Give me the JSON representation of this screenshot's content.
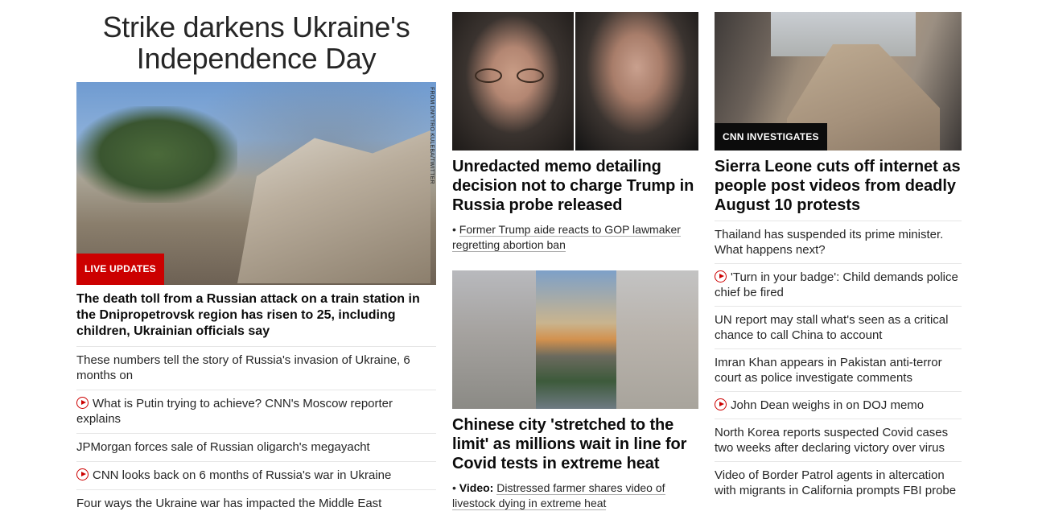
{
  "left": {
    "headline": "Strike darkens Ukraine's Independence Day",
    "image_credit": "FROM DMYTRO KULEBA/TWITTER",
    "badge": "LIVE UPDATES",
    "lead_title": "The death toll from a Russian attack on a train station in the Dnipropetrovsk region has risen to 25, including children, Ukrainian officials say",
    "items": [
      {
        "text": "These numbers tell the story of Russia's invasion of Ukraine, 6 months on",
        "video": false
      },
      {
        "text": "What is Putin trying to achieve? CNN's Moscow reporter explains",
        "video": true
      },
      {
        "text": "JPMorgan forces sale of Russian oligarch's megayacht",
        "video": false
      },
      {
        "text": "CNN looks back on 6 months of Russia's war in Ukraine",
        "video": true
      },
      {
        "text": "Four ways the Ukraine war has impacted the Middle East",
        "video": false
      }
    ]
  },
  "middle": {
    "story1": {
      "title": "Unredacted memo detailing decision not to charge Trump in Russia probe released",
      "bullet": "•",
      "link": "Former Trump aide reacts to GOP lawmaker regretting abortion ban"
    },
    "story2": {
      "title": "Chinese city 'stretched to the limit' as millions wait in line for Covid tests in extreme heat",
      "bullet": "•",
      "label": "Video:",
      "link": "Distressed farmer shares video of livestock dying in extreme heat"
    }
  },
  "right": {
    "badge": "CNN INVESTIGATES",
    "title": "Sierra Leone cuts off internet as people post videos from deadly August 10 protests",
    "items": [
      {
        "text": "Thailand has suspended its prime minister. What happens next?",
        "video": false
      },
      {
        "text": "'Turn in your badge': Child demands police chief be fired",
        "video": true
      },
      {
        "text": "UN report may stall what's seen as a critical chance to call China to account",
        "video": false
      },
      {
        "text": "Imran Khan appears in Pakistan anti-terror court as police investigate comments",
        "video": false
      },
      {
        "text": "John Dean weighs in on DOJ memo",
        "video": true
      },
      {
        "text": "North Korea reports suspected Covid cases two weeks after declaring victory over virus",
        "video": false
      },
      {
        "text": "Video of Border Patrol agents in altercation with migrants in California prompts FBI probe",
        "video": false
      }
    ]
  },
  "colors": {
    "accent_red": "#cc0000",
    "text": "#0c0c0c",
    "divider": "#e6e6e6"
  }
}
